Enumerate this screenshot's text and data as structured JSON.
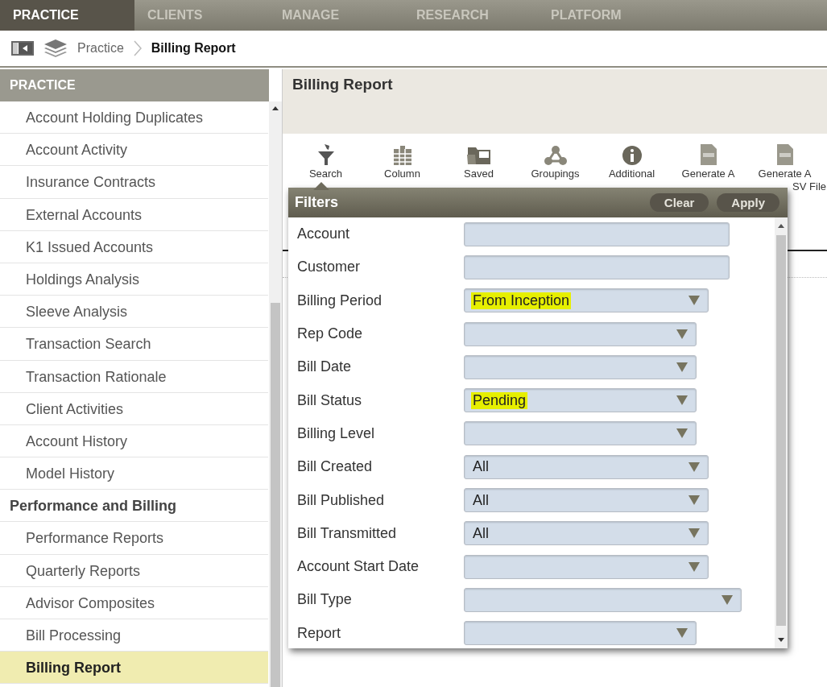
{
  "top_nav": {
    "tabs": [
      {
        "label": "PRACTICE",
        "selected": true
      },
      {
        "label": "CLIENTS",
        "selected": false
      },
      {
        "label": "MANAGE",
        "selected": false
      },
      {
        "label": "RESEARCH",
        "selected": false
      },
      {
        "label": "PLATFORM",
        "selected": false
      }
    ]
  },
  "breadcrumb": {
    "items": [
      "Practice",
      "Billing Report"
    ]
  },
  "sidebar": {
    "title": "PRACTICE",
    "items": [
      {
        "label": "Account Holding Duplicates",
        "kind": "link",
        "selected": false
      },
      {
        "label": "Account Activity",
        "kind": "link",
        "selected": false
      },
      {
        "label": "Insurance Contracts",
        "kind": "link",
        "selected": false
      },
      {
        "label": "External Accounts",
        "kind": "link",
        "selected": false
      },
      {
        "label": "K1 Issued Accounts",
        "kind": "link",
        "selected": false
      },
      {
        "label": "Holdings Analysis",
        "kind": "link",
        "selected": false
      },
      {
        "label": "Sleeve Analysis",
        "kind": "link",
        "selected": false
      },
      {
        "label": "Transaction Search",
        "kind": "link",
        "selected": false
      },
      {
        "label": "Transaction Rationale",
        "kind": "link",
        "selected": false
      },
      {
        "label": "Client Activities",
        "kind": "link",
        "selected": false
      },
      {
        "label": "Account History",
        "kind": "link",
        "selected": false
      },
      {
        "label": "Model History",
        "kind": "link",
        "selected": false
      },
      {
        "label": "Performance and Billing",
        "kind": "section",
        "selected": false
      },
      {
        "label": "Performance Reports",
        "kind": "link",
        "selected": false
      },
      {
        "label": "Quarterly Reports",
        "kind": "link",
        "selected": false
      },
      {
        "label": "Advisor Composites",
        "kind": "link",
        "selected": false
      },
      {
        "label": "Bill Processing",
        "kind": "link",
        "selected": false
      },
      {
        "label": "Billing Report",
        "kind": "link",
        "selected": true
      }
    ]
  },
  "main": {
    "title": "Billing Report",
    "toolbar": [
      {
        "label": [
          "Search"
        ]
      },
      {
        "label": [
          "Column"
        ]
      },
      {
        "label": [
          "Saved"
        ]
      },
      {
        "label": [
          "Groupings"
        ]
      },
      {
        "label": [
          "Additional"
        ]
      },
      {
        "label": [
          "Generate A"
        ]
      },
      {
        "label": [
          "Generate A",
          "SV File"
        ]
      }
    ]
  },
  "filters": {
    "title": "Filters",
    "buttons": [
      "Clear",
      "Apply"
    ],
    "fields": [
      {
        "label": "Account",
        "kind": "text"
      },
      {
        "label": "Customer",
        "kind": "text"
      },
      {
        "label": "Billing Period",
        "kind": "select",
        "value": "From Inception",
        "highlighted": true
      },
      {
        "label": "Rep Code",
        "kind": "select"
      },
      {
        "label": "Bill Date",
        "kind": "select"
      },
      {
        "label": "Bill Status",
        "kind": "select",
        "value": "Pending",
        "highlighted": true
      },
      {
        "label": "Billing Level",
        "kind": "select"
      },
      {
        "label": "Bill Created",
        "kind": "select",
        "value": "All",
        "highlighted": false
      },
      {
        "label": "Bill Published",
        "kind": "select",
        "value": "All",
        "highlighted": false
      },
      {
        "label": "Bill Transmitted",
        "kind": "select",
        "value": "All",
        "highlighted": false
      },
      {
        "label": "Account Start Date",
        "kind": "select"
      },
      {
        "label": "Bill Type",
        "kind": "select"
      },
      {
        "label": "Report",
        "kind": "select"
      }
    ]
  }
}
